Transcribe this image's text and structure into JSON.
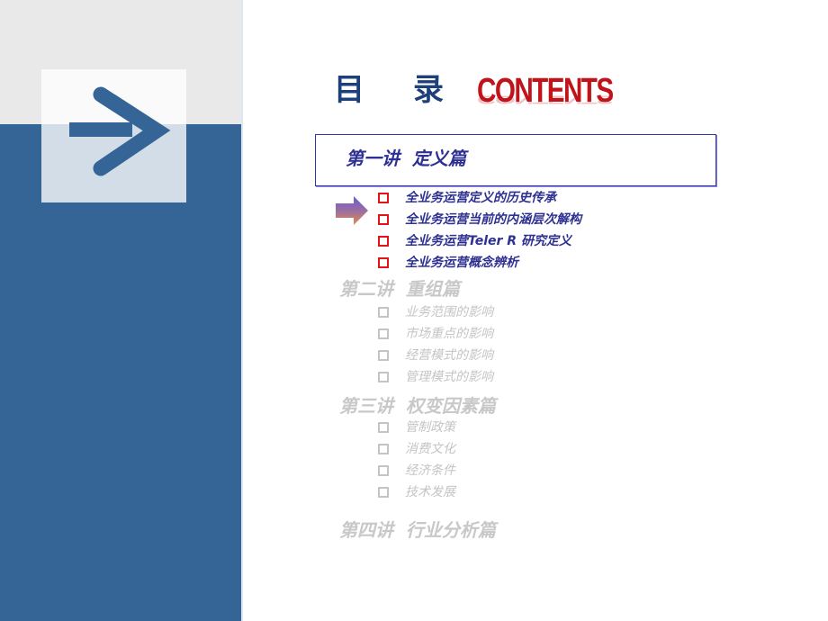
{
  "title": {
    "chinese_first": "目",
    "chinese_second": "录",
    "english": "CONTENTS"
  },
  "colors": {
    "left_panel_top": "#e9e9e9",
    "left_panel_bottom": "#356597",
    "title_blue": "#1d3f7a",
    "contents_red": "#c0141a",
    "active_text": "#2e3192",
    "active_bullet": "#e0141a",
    "inactive_text": "#c4c4c4"
  },
  "icons": {
    "panel_icon": "arrow-right-icon",
    "pointer": "gradient-arrow-pointer-icon",
    "bullet": "hollow-square-bullet-icon"
  },
  "sections": [
    {
      "title": "第一讲  定义篇",
      "active": true,
      "items": [
        "全业务运营定义的历史传承",
        "全业务运营当前的内涵层次解构",
        "全业务运营Teler R 研究定义",
        "全业务运营概念辨析"
      ]
    },
    {
      "title": "第二讲  重组篇",
      "active": false,
      "items": [
        "业务范围的影响",
        "市场重点的影响",
        "经营模式的影响",
        "管理模式的影响"
      ]
    },
    {
      "title": "第三讲  权变因素篇",
      "active": false,
      "items": [
        "管制政策",
        "消费文化",
        "经济条件",
        "技术发展"
      ]
    },
    {
      "title": "第四讲  行业分析篇",
      "active": false,
      "items": []
    }
  ]
}
